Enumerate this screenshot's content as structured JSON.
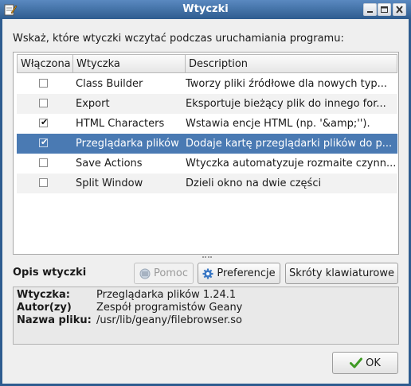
{
  "window": {
    "title": "Wtyczki",
    "app_icon": "pencil-paper-icon",
    "controls": [
      "minimize-icon",
      "maximize-icon",
      "close-icon"
    ]
  },
  "prompt": "Wskaż, które wtyczki wczytać podczas uruchamiania programu:",
  "plugin_list": {
    "columns": [
      "Włączona",
      "Wtyczka",
      "Description"
    ],
    "rows": [
      {
        "enabled": false,
        "name": "Class Builder",
        "description": "Tworzy pliki źródłowe dla nowych typ..."
      },
      {
        "enabled": false,
        "name": "Export",
        "description": "Eksportuje bieżący plik do innego for..."
      },
      {
        "enabled": true,
        "name": "HTML Characters",
        "description": "Wstawia encje HTML (np. '&amp;'')."
      },
      {
        "enabled": true,
        "name": "Przeglądarka plików",
        "description": "Dodaje kartę przeglądarki plików do p...",
        "selected": true
      },
      {
        "enabled": false,
        "name": "Save Actions",
        "description": "Wtyczka automatyzuje rozmaite czynn..."
      },
      {
        "enabled": false,
        "name": "Split Window",
        "description": "Dzieli okno na dwie części"
      }
    ],
    "selection_color": "#4a7ab3"
  },
  "details": {
    "section_label": "Opis wtyczki",
    "help_button": "Pomoc",
    "prefs_button": "Preferencje",
    "keys_button": "Skróty klawiaturowe",
    "plugin_key": "Wtyczka:",
    "plugin_value": "Przeglądarka plików 1.24.1",
    "author_key": "Autor(zy)",
    "author_value": "Zespół programistów Geany",
    "file_key": "Nazwa pliku:",
    "file_value": "/usr/lib/geany/filebrowser.so"
  },
  "footer": {
    "ok_button": "OK",
    "ok_icon": "checkmark-icon"
  }
}
